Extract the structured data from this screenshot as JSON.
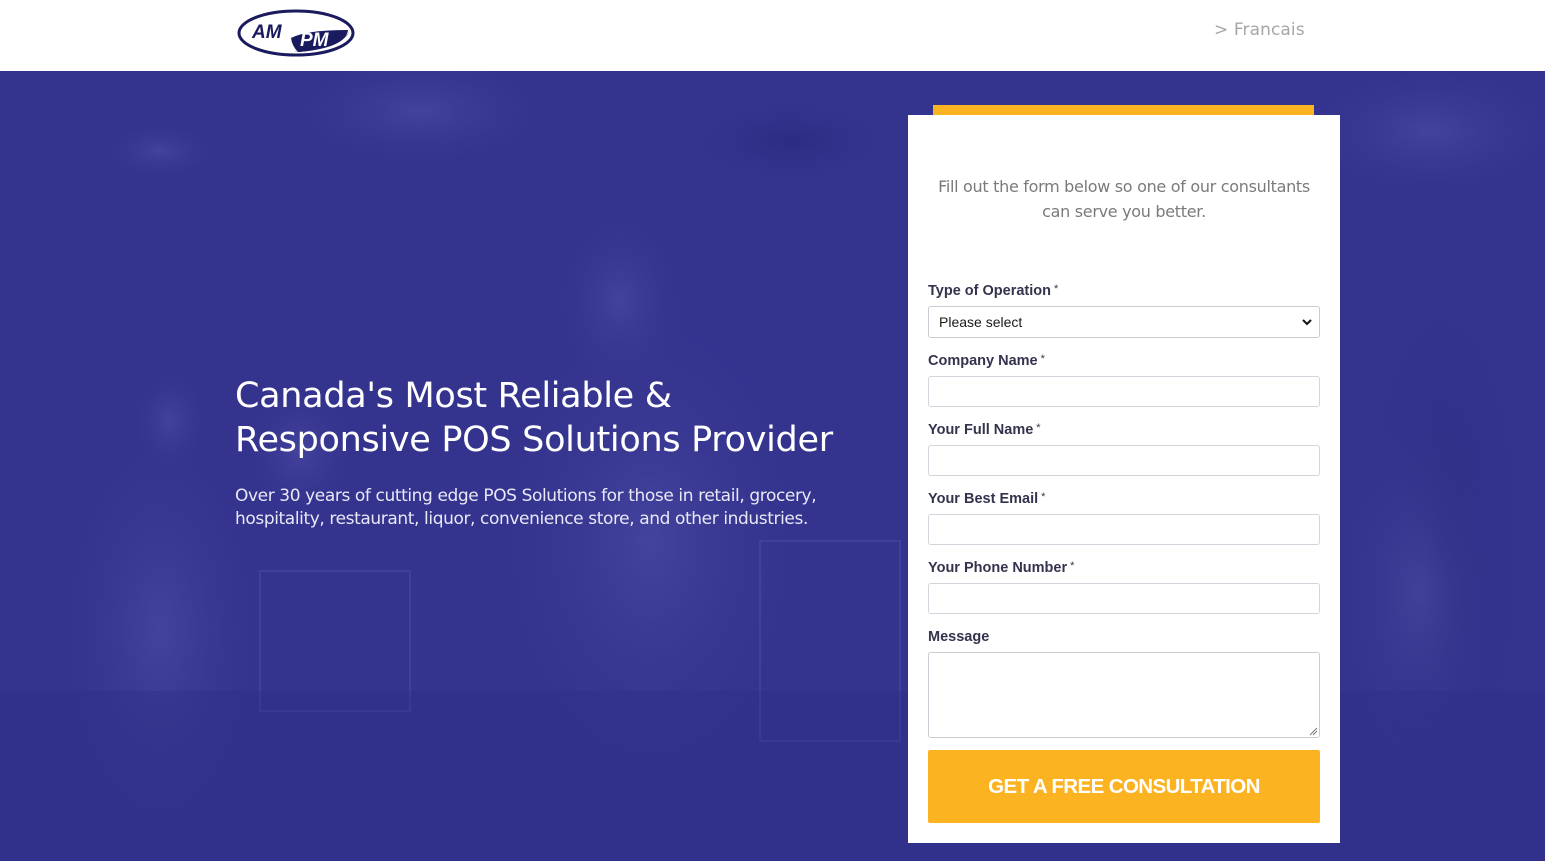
{
  "header": {
    "logo_text_left": "AM",
    "logo_text_right": "PM",
    "language_link": "> Francais"
  },
  "hero": {
    "title_line1": "Canada's Most Reliable &",
    "title_line2": "Responsive POS Solutions Provider",
    "subtitle_line1": "Over 30 years of cutting edge POS Solutions for those in retail, grocery,",
    "subtitle_line2": "hospitality, restaurant, liquor, convenience store, and other industries."
  },
  "form": {
    "intro_line1": "Fill out the form below so one of our consultants",
    "intro_line2": "can serve you better.",
    "required_marker": "*",
    "operation_label": "Type of Operation",
    "operation_value": "Please select",
    "company_label": "Company Name",
    "company_value": "",
    "name_label": "Your Full Name",
    "name_value": "",
    "email_label": "Your Best Email",
    "email_value": "",
    "phone_label": "Your Phone Number",
    "phone_value": "",
    "message_label": "Message",
    "message_value": "",
    "submit_label": "GET A FREE CONSULTATION"
  },
  "colors": {
    "hero_overlay": "#34348f",
    "accent": "#fcb321",
    "logo_navy": "#1a1a5e"
  }
}
